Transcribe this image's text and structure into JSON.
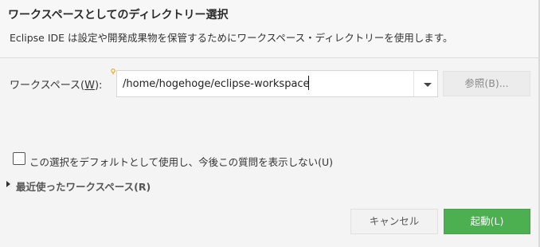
{
  "colors": {
    "accent": "#4caf50",
    "header_bg": "#f7f7f7",
    "body_bg": "#f4f4f4",
    "hint_bulb": "#f0a000"
  },
  "header": {
    "title": "ワークスペースとしてのディレクトリー選択",
    "description": "Eclipse IDE は設定や開発成果物を保管するためにワークスペース・ディレクトリーを使用します。"
  },
  "workspace": {
    "label_prefix": "ワークスペース(",
    "label_mnemonic": "W",
    "label_suffix": "):",
    "value": "/home/hogehoge/eclipse-workspace",
    "hint_icon": "lightbulb-icon",
    "dropdown_icon": "chevron-down-icon",
    "browse_label": "参照(B)..."
  },
  "options": {
    "default_checkbox_label": "この選択をデフォルトとして使用し、今後この質問を表示しない(U)",
    "default_checked": false,
    "recent_label": "最近使ったワークスペース(R)",
    "recent_icon": "triangle-right-icon"
  },
  "footer": {
    "cancel_label": "キャンセル",
    "launch_label": "起動(L)"
  }
}
